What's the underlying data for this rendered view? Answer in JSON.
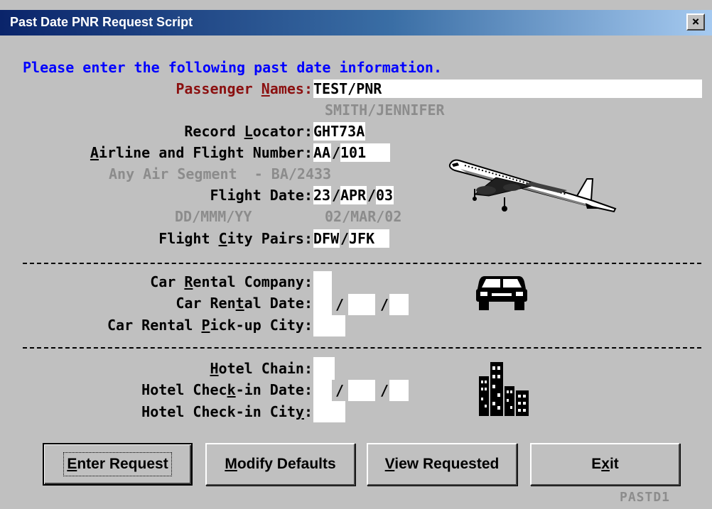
{
  "window": {
    "title": "Past Date PNR Request Script",
    "close_glyph": "×"
  },
  "prompt": "Please enter the following past date information.",
  "fields": {
    "passenger_names_label": "Passenger Names:",
    "passenger_names_value": "TEST/PNR",
    "passenger_names_hint": "SMITH/JENNIFER",
    "record_locator_label": "Record Locator:",
    "record_locator_value": "GHT73A",
    "airline_flight_label": "Airline and Flight Number:",
    "airline_value": "AA",
    "flight_number_value": "101",
    "any_air_segment_hint": "Any Air Segment  - BA/2433",
    "flight_date_label": "Flight Date:",
    "flight_day_value": "23",
    "flight_month_value": "APR",
    "flight_year_value": "03",
    "date_format_hint": "DD/MMM/YY",
    "date_example_hint": "02/MAR/02",
    "city_pairs_label": "Flight City Pairs:",
    "city_from_value": "DFW",
    "city_to_value": "JFK",
    "car_company_label": "Car Rental Company:",
    "car_company_value": "",
    "car_date_label": "Car Rental Date:",
    "car_day_value": "",
    "car_month_value": "",
    "car_year_value": "",
    "car_city_label": "Car Rental Pick-up City:",
    "car_city_value": "",
    "hotel_chain_label": "Hotel Chain:",
    "hotel_chain_value": "",
    "hotel_date_label": "Hotel Check-in Date:",
    "hotel_day_value": "",
    "hotel_month_value": "",
    "hotel_year_value": "",
    "hotel_city_label": "Hotel Check-in City:",
    "hotel_city_value": ""
  },
  "slash": "/",
  "icons": [
    "airplane-icon",
    "car-icon",
    "city-buildings-icon"
  ],
  "buttons": {
    "enter_request": "Enter Request",
    "modify_defaults": "Modify Defaults",
    "view_requested": "View Requested",
    "exit": "Exit"
  },
  "screen_id": "PASTD1",
  "colors": {
    "prompt": "#0000ff",
    "required_label": "#8b1010",
    "hint": "#8c8c8c",
    "window_bg": "#c0c0c0"
  }
}
